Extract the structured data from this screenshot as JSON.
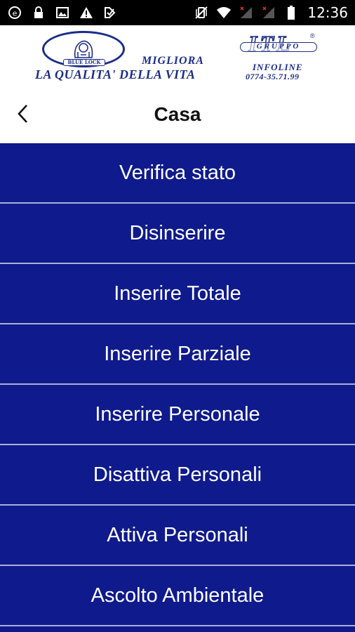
{
  "status_bar": {
    "time": "12:36",
    "left_icons": [
      "notification-e-icon",
      "lock-icon",
      "image-icon",
      "warning-icon",
      "download-check-icon"
    ],
    "right_icons": [
      "vibrate-icon",
      "wifi-icon",
      "signal-icon",
      "signal-icon",
      "battery-icon"
    ]
  },
  "logo": {
    "brand_ribbon": "BLUE LOCK",
    "migliora": "MIGLIORA",
    "slogan": "LA QUALITA' DELLA VITA",
    "itl": "ITL",
    "itl_registered": "®",
    "gruppo": "GRUPPO",
    "infoline": "INFOLINE",
    "phone": "0774-35.71.99"
  },
  "header": {
    "title": "Casa",
    "back_icon": "chevron-left-icon"
  },
  "menu": {
    "items": [
      {
        "label": "Verifica stato"
      },
      {
        "label": "Disinserire"
      },
      {
        "label": "Inserire Totale"
      },
      {
        "label": "Inserire Parziale"
      },
      {
        "label": "Inserire Personale"
      },
      {
        "label": "Disattiva Personali"
      },
      {
        "label": "Attiva Personali"
      },
      {
        "label": "Ascolto Ambientale"
      }
    ]
  },
  "colors": {
    "menu_background": "#0f1a8c",
    "menu_divider": "#aab0d8",
    "logo_blue": "#1b2c8a",
    "status_bar": "#000000"
  }
}
